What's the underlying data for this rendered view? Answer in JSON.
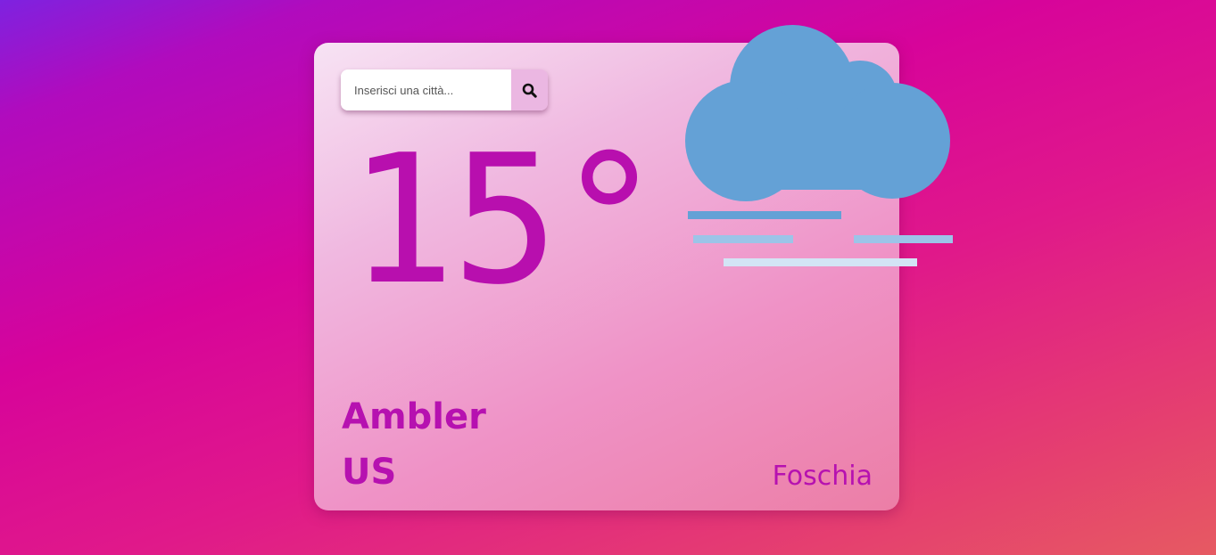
{
  "search": {
    "placeholder": "Inserisci una città...",
    "button_icon": "search-icon"
  },
  "weather": {
    "temperature": "15°",
    "city": "Ambler",
    "country": "US",
    "condition": "Foschia",
    "icon": "fog-cloud-icon"
  },
  "colors": {
    "accent": "#b611b0",
    "cloud": "#64a1d6",
    "search_button_bg": "#ebb7e2"
  }
}
